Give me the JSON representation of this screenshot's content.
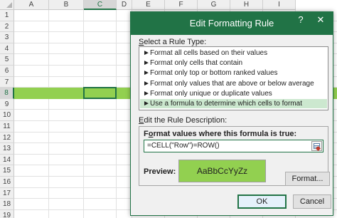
{
  "sheet": {
    "columns": [
      "A",
      "B",
      "C",
      "D",
      "E",
      "F",
      "G",
      "H",
      "I"
    ],
    "rows": [
      "1",
      "2",
      "3",
      "4",
      "5",
      "6",
      "7",
      "8",
      "9",
      "10",
      "11",
      "12",
      "13",
      "14",
      "15",
      "16",
      "17",
      "18",
      "19"
    ],
    "selected_column": "C",
    "selected_row": "8",
    "highlight_color": "#92d050",
    "accent_color": "#217346"
  },
  "dialog": {
    "title": "Edit Formatting Rule",
    "help_label": "?",
    "close_label": "✕",
    "select_type_label_pre": "",
    "select_type_label_key": "S",
    "select_type_label_post": "elect a Rule Type:",
    "rule_types": [
      "Format all cells based on their values",
      "Format only cells that contain",
      "Format only top or bottom ranked values",
      "Format only values that are above or below average",
      "Format only unique or duplicate values",
      "Use a formula to determine which cells to format"
    ],
    "selected_rule_index": 5,
    "bullet": "►",
    "edit_desc_label_pre": "",
    "edit_desc_label_key": "E",
    "edit_desc_label_post": "dit the Rule Description:",
    "formula_label_pre": "F",
    "formula_label_key": "o",
    "formula_label_post": "rmat values where this formula is true:",
    "formula_value": "=CELL(\"Row\")=ROW()",
    "preview_label": "Preview:",
    "preview_sample": "AaBbCcYyZz",
    "format_button": "Format...",
    "ok_button": "OK",
    "cancel_button": "Cancel"
  }
}
